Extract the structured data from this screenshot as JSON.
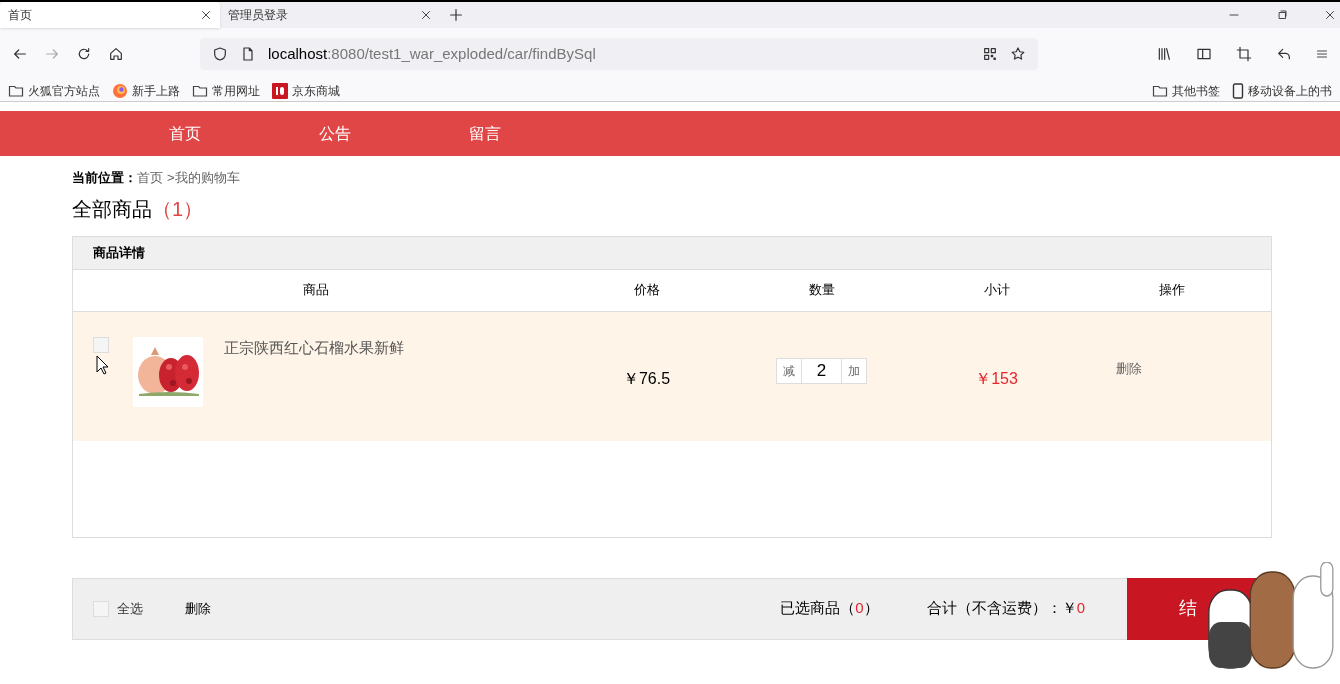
{
  "browser": {
    "tabs": [
      {
        "title": "首页",
        "selected": true
      },
      {
        "title": "管理员登录",
        "selected": false
      }
    ],
    "url": {
      "host": "localhost",
      "rest": ":8080/test1_war_exploded/car/findBySql"
    },
    "bookmarks": [
      {
        "label": "火狐官方站点",
        "kind": "folder"
      },
      {
        "label": "新手上路",
        "kind": "firefox"
      },
      {
        "label": "常用网址",
        "kind": "folder"
      },
      {
        "label": "京东商城",
        "kind": "jd"
      }
    ],
    "bookmarks_right": [
      {
        "label": "其他书签",
        "kind": "folder"
      },
      {
        "label": "移动设备上的书",
        "kind": "mobile"
      }
    ]
  },
  "nav": {
    "items": [
      "首页",
      "公告",
      "留言"
    ]
  },
  "breadcrumb": {
    "label": "当前位置：",
    "home": "首页",
    "current": ">我的购物车"
  },
  "heading": {
    "title": "全部商品",
    "count": "（1）"
  },
  "cart": {
    "section_title": "商品详情",
    "columns": [
      "商品",
      "价格",
      "数量",
      "小计",
      "操作"
    ],
    "rows": [
      {
        "checked": false,
        "name": "正宗陕西红心石榴水果新鲜",
        "price": "￥76.5",
        "decrease": "减",
        "quantity": "2",
        "increase": "加",
        "subtotal": "￥153",
        "action": "删除"
      }
    ]
  },
  "footer": {
    "select_all": {
      "label": "全选",
      "checked": false
    },
    "delete": "删除",
    "selected_label": "已选商品（",
    "selected_count": "0",
    "selected_close": "）",
    "total_label": "合计（不含运费）：",
    "currency": "￥",
    "total": "0",
    "checkout": "结"
  }
}
